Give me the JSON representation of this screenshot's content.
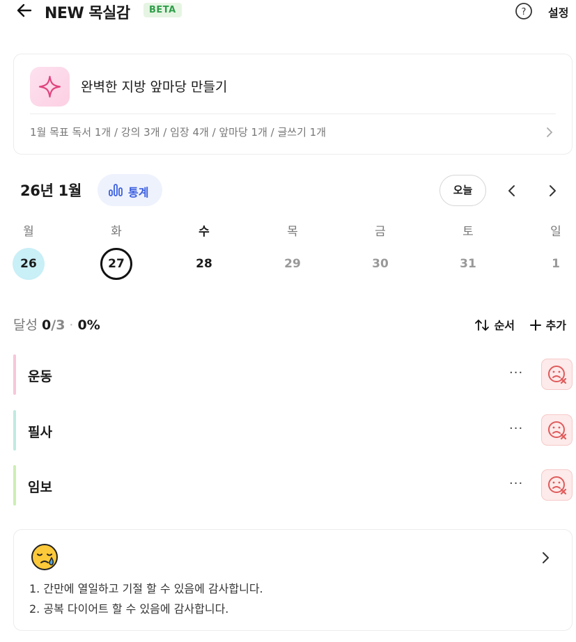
{
  "header": {
    "title": "NEW 목실감",
    "badge": "BETA",
    "settings_label": "설정"
  },
  "goal": {
    "title": "완벽한 지방 앞마당 만들기",
    "summary": "1월 목표  독서 1개 / 강의 3개 / 임장 4개 / 앞마당 1개 / 글쓰기 1개"
  },
  "calendar": {
    "month_label": "26년 1월",
    "stats_label": "통계",
    "today_label": "오늘",
    "weekdays": [
      "월",
      "화",
      "수",
      "목",
      "금",
      "토",
      "일"
    ],
    "dates": [
      "26",
      "27",
      "28",
      "29",
      "30",
      "31",
      "1"
    ]
  },
  "progress": {
    "label": "달성",
    "done": "0",
    "total": "/3",
    "percent": "0%"
  },
  "actions": {
    "order_label": "순서",
    "add_label": "추가"
  },
  "habits": [
    {
      "name": "운동",
      "color": "#f7c6d9",
      "more": "···"
    },
    {
      "name": "필사",
      "color": "#bfeadf",
      "more": "···"
    },
    {
      "name": "임보",
      "color": "#cdeeb5",
      "more": "···"
    }
  ],
  "note": {
    "lines": [
      "1. 간만에 열일하고 기절 할 수 있음에 감사합니다.",
      "2. 공복 다이어트 할 수 있음에 감사합니다."
    ]
  },
  "colors": {
    "accent": "#3b5fe0",
    "beta": "#2e9e4a",
    "today_fill": "#c9eff7",
    "status_red": "#e05a5a"
  }
}
